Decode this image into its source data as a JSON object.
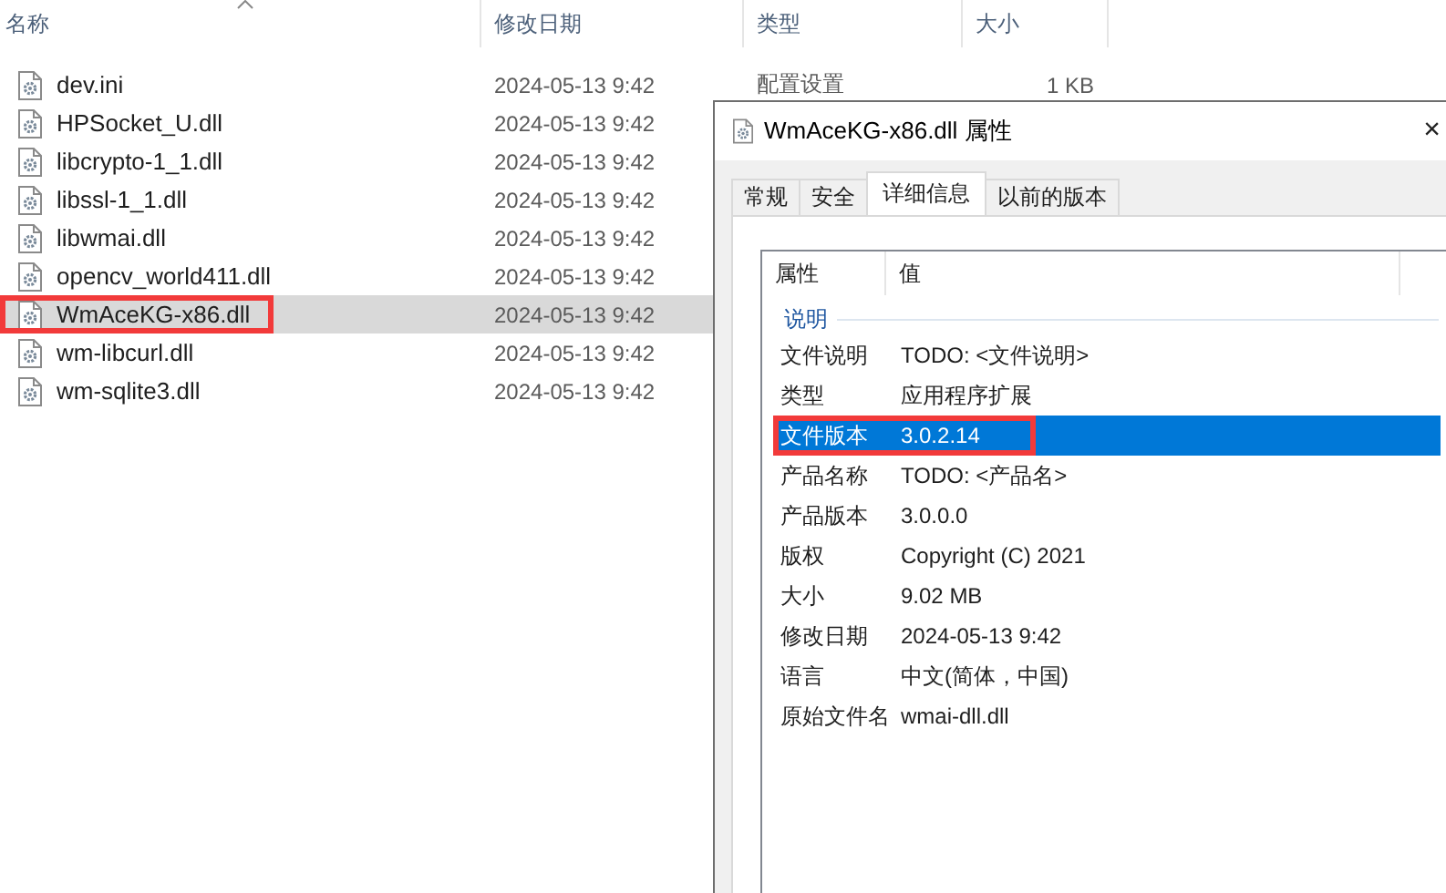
{
  "explorer": {
    "columns": [
      {
        "label": "名称",
        "sorted": true
      },
      {
        "label": "修改日期",
        "sorted": false
      },
      {
        "label": "类型",
        "sorted": false
      },
      {
        "label": "大小",
        "sorted": false
      }
    ],
    "files": [
      {
        "name": "dev.ini",
        "date": "2024-05-13 9:42",
        "type": "配置设置",
        "size": "1 KB",
        "selected": false,
        "highlighted": false
      },
      {
        "name": "HPSocket_U.dll",
        "date": "2024-05-13 9:42",
        "selected": false,
        "highlighted": false
      },
      {
        "name": "libcrypto-1_1.dll",
        "date": "2024-05-13 9:42",
        "selected": false,
        "highlighted": false
      },
      {
        "name": "libssl-1_1.dll",
        "date": "2024-05-13 9:42",
        "selected": false,
        "highlighted": false
      },
      {
        "name": "libwmai.dll",
        "date": "2024-05-13 9:42",
        "selected": false,
        "highlighted": false
      },
      {
        "name": "opencv_world411.dll",
        "date": "2024-05-13 9:42",
        "selected": false,
        "highlighted": false
      },
      {
        "name": "WmAceKG-x86.dll",
        "date": "2024-05-13 9:42",
        "selected": true,
        "highlighted": true
      },
      {
        "name": "wm-libcurl.dll",
        "date": "2024-05-13 9:42",
        "selected": false,
        "highlighted": false
      },
      {
        "name": "wm-sqlite3.dll",
        "date": "2024-05-13 9:42",
        "selected": false,
        "highlighted": false
      }
    ]
  },
  "dialog": {
    "title": "WmAceKG-x86.dll 属性",
    "close": "×",
    "tabs": [
      {
        "label": "常规",
        "selected": false
      },
      {
        "label": "安全",
        "selected": false
      },
      {
        "label": "详细信息",
        "selected": true
      },
      {
        "label": "以前的版本",
        "selected": false
      }
    ],
    "columns": [
      "属性",
      "值"
    ],
    "group": "说明",
    "properties": [
      {
        "name": "文件说明",
        "value": "TODO: <文件说明>",
        "selected": false,
        "highlighted": false
      },
      {
        "name": "类型",
        "value": "应用程序扩展",
        "selected": false,
        "highlighted": false
      },
      {
        "name": "文件版本",
        "value": "3.0.2.14",
        "selected": true,
        "highlighted": true
      },
      {
        "name": "产品名称",
        "value": "TODO: <产品名>",
        "selected": false,
        "highlighted": false
      },
      {
        "name": "产品版本",
        "value": "3.0.0.0",
        "selected": false,
        "highlighted": false
      },
      {
        "name": "版权",
        "value": "Copyright (C) 2021",
        "selected": false,
        "highlighted": false
      },
      {
        "name": "大小",
        "value": "9.02 MB",
        "selected": false,
        "highlighted": false
      },
      {
        "name": "修改日期",
        "value": "2024-05-13 9:42",
        "selected": false,
        "highlighted": false
      },
      {
        "name": "语言",
        "value": "中文(简体，中国)",
        "selected": false,
        "highlighted": false
      },
      {
        "name": "原始文件名",
        "value": "wmai-dll.dll",
        "selected": false,
        "highlighted": false
      }
    ]
  }
}
